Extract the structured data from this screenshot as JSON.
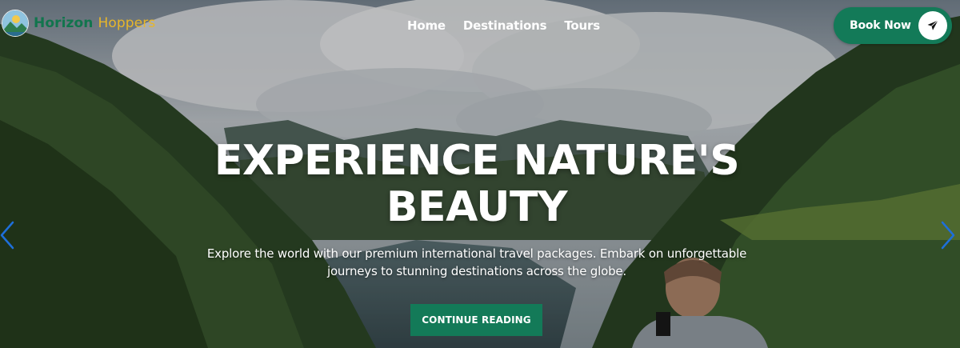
{
  "brand": {
    "word1": "Horizon",
    "word2": "Hoppers"
  },
  "nav": {
    "items": [
      "Home",
      "Destinations",
      "Tours"
    ]
  },
  "header": {
    "book_label": "Book Now"
  },
  "hero": {
    "headline_line1": "EXPERIENCE NATURE'S",
    "headline_line2": "BEAUTY",
    "subtitle_line1": "Explore the world with our premium international travel packages. Embark on unforgettable",
    "subtitle_line2": "journeys to stunning destinations across the globe.",
    "cta_label": "CONTINUE READING"
  },
  "carousel": {
    "prev_icon": "chevron-left-icon",
    "next_icon": "chevron-right-icon"
  },
  "colors": {
    "brand_green": "#137a58",
    "brand_gold": "#e7b62a",
    "arrow_blue": "#1e6fd9"
  }
}
